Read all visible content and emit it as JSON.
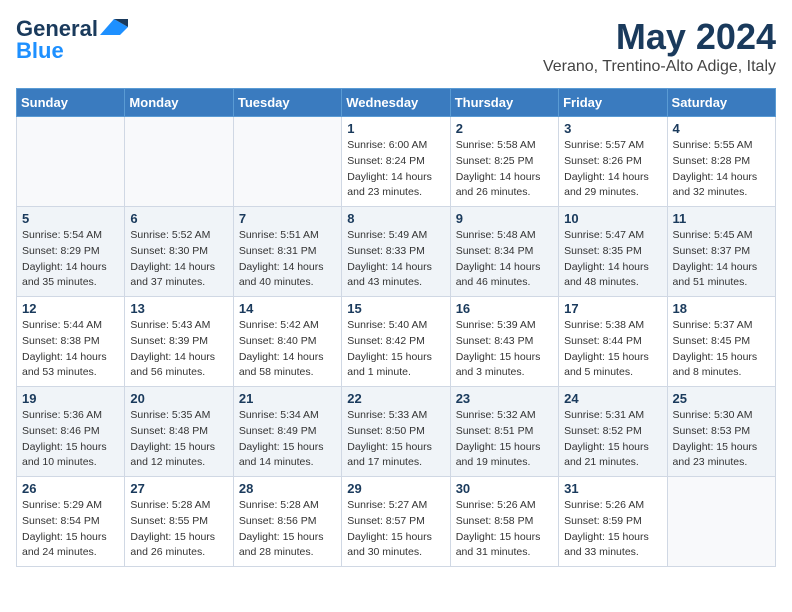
{
  "logo": {
    "general": "General",
    "blue": "Blue"
  },
  "title": "May 2024",
  "location": "Verano, Trentino-Alto Adige, Italy",
  "days_of_week": [
    "Sunday",
    "Monday",
    "Tuesday",
    "Wednesday",
    "Thursday",
    "Friday",
    "Saturday"
  ],
  "weeks": [
    [
      {
        "day": "",
        "sunrise": "",
        "sunset": "",
        "daylight": ""
      },
      {
        "day": "",
        "sunrise": "",
        "sunset": "",
        "daylight": ""
      },
      {
        "day": "",
        "sunrise": "",
        "sunset": "",
        "daylight": ""
      },
      {
        "day": "1",
        "sunrise": "Sunrise: 6:00 AM",
        "sunset": "Sunset: 8:24 PM",
        "daylight": "Daylight: 14 hours and 23 minutes."
      },
      {
        "day": "2",
        "sunrise": "Sunrise: 5:58 AM",
        "sunset": "Sunset: 8:25 PM",
        "daylight": "Daylight: 14 hours and 26 minutes."
      },
      {
        "day": "3",
        "sunrise": "Sunrise: 5:57 AM",
        "sunset": "Sunset: 8:26 PM",
        "daylight": "Daylight: 14 hours and 29 minutes."
      },
      {
        "day": "4",
        "sunrise": "Sunrise: 5:55 AM",
        "sunset": "Sunset: 8:28 PM",
        "daylight": "Daylight: 14 hours and 32 minutes."
      }
    ],
    [
      {
        "day": "5",
        "sunrise": "Sunrise: 5:54 AM",
        "sunset": "Sunset: 8:29 PM",
        "daylight": "Daylight: 14 hours and 35 minutes."
      },
      {
        "day": "6",
        "sunrise": "Sunrise: 5:52 AM",
        "sunset": "Sunset: 8:30 PM",
        "daylight": "Daylight: 14 hours and 37 minutes."
      },
      {
        "day": "7",
        "sunrise": "Sunrise: 5:51 AM",
        "sunset": "Sunset: 8:31 PM",
        "daylight": "Daylight: 14 hours and 40 minutes."
      },
      {
        "day": "8",
        "sunrise": "Sunrise: 5:49 AM",
        "sunset": "Sunset: 8:33 PM",
        "daylight": "Daylight: 14 hours and 43 minutes."
      },
      {
        "day": "9",
        "sunrise": "Sunrise: 5:48 AM",
        "sunset": "Sunset: 8:34 PM",
        "daylight": "Daylight: 14 hours and 46 minutes."
      },
      {
        "day": "10",
        "sunrise": "Sunrise: 5:47 AM",
        "sunset": "Sunset: 8:35 PM",
        "daylight": "Daylight: 14 hours and 48 minutes."
      },
      {
        "day": "11",
        "sunrise": "Sunrise: 5:45 AM",
        "sunset": "Sunset: 8:37 PM",
        "daylight": "Daylight: 14 hours and 51 minutes."
      }
    ],
    [
      {
        "day": "12",
        "sunrise": "Sunrise: 5:44 AM",
        "sunset": "Sunset: 8:38 PM",
        "daylight": "Daylight: 14 hours and 53 minutes."
      },
      {
        "day": "13",
        "sunrise": "Sunrise: 5:43 AM",
        "sunset": "Sunset: 8:39 PM",
        "daylight": "Daylight: 14 hours and 56 minutes."
      },
      {
        "day": "14",
        "sunrise": "Sunrise: 5:42 AM",
        "sunset": "Sunset: 8:40 PM",
        "daylight": "Daylight: 14 hours and 58 minutes."
      },
      {
        "day": "15",
        "sunrise": "Sunrise: 5:40 AM",
        "sunset": "Sunset: 8:42 PM",
        "daylight": "Daylight: 15 hours and 1 minute."
      },
      {
        "day": "16",
        "sunrise": "Sunrise: 5:39 AM",
        "sunset": "Sunset: 8:43 PM",
        "daylight": "Daylight: 15 hours and 3 minutes."
      },
      {
        "day": "17",
        "sunrise": "Sunrise: 5:38 AM",
        "sunset": "Sunset: 8:44 PM",
        "daylight": "Daylight: 15 hours and 5 minutes."
      },
      {
        "day": "18",
        "sunrise": "Sunrise: 5:37 AM",
        "sunset": "Sunset: 8:45 PM",
        "daylight": "Daylight: 15 hours and 8 minutes."
      }
    ],
    [
      {
        "day": "19",
        "sunrise": "Sunrise: 5:36 AM",
        "sunset": "Sunset: 8:46 PM",
        "daylight": "Daylight: 15 hours and 10 minutes."
      },
      {
        "day": "20",
        "sunrise": "Sunrise: 5:35 AM",
        "sunset": "Sunset: 8:48 PM",
        "daylight": "Daylight: 15 hours and 12 minutes."
      },
      {
        "day": "21",
        "sunrise": "Sunrise: 5:34 AM",
        "sunset": "Sunset: 8:49 PM",
        "daylight": "Daylight: 15 hours and 14 minutes."
      },
      {
        "day": "22",
        "sunrise": "Sunrise: 5:33 AM",
        "sunset": "Sunset: 8:50 PM",
        "daylight": "Daylight: 15 hours and 17 minutes."
      },
      {
        "day": "23",
        "sunrise": "Sunrise: 5:32 AM",
        "sunset": "Sunset: 8:51 PM",
        "daylight": "Daylight: 15 hours and 19 minutes."
      },
      {
        "day": "24",
        "sunrise": "Sunrise: 5:31 AM",
        "sunset": "Sunset: 8:52 PM",
        "daylight": "Daylight: 15 hours and 21 minutes."
      },
      {
        "day": "25",
        "sunrise": "Sunrise: 5:30 AM",
        "sunset": "Sunset: 8:53 PM",
        "daylight": "Daylight: 15 hours and 23 minutes."
      }
    ],
    [
      {
        "day": "26",
        "sunrise": "Sunrise: 5:29 AM",
        "sunset": "Sunset: 8:54 PM",
        "daylight": "Daylight: 15 hours and 24 minutes."
      },
      {
        "day": "27",
        "sunrise": "Sunrise: 5:28 AM",
        "sunset": "Sunset: 8:55 PM",
        "daylight": "Daylight: 15 hours and 26 minutes."
      },
      {
        "day": "28",
        "sunrise": "Sunrise: 5:28 AM",
        "sunset": "Sunset: 8:56 PM",
        "daylight": "Daylight: 15 hours and 28 minutes."
      },
      {
        "day": "29",
        "sunrise": "Sunrise: 5:27 AM",
        "sunset": "Sunset: 8:57 PM",
        "daylight": "Daylight: 15 hours and 30 minutes."
      },
      {
        "day": "30",
        "sunrise": "Sunrise: 5:26 AM",
        "sunset": "Sunset: 8:58 PM",
        "daylight": "Daylight: 15 hours and 31 minutes."
      },
      {
        "day": "31",
        "sunrise": "Sunrise: 5:26 AM",
        "sunset": "Sunset: 8:59 PM",
        "daylight": "Daylight: 15 hours and 33 minutes."
      },
      {
        "day": "",
        "sunrise": "",
        "sunset": "",
        "daylight": ""
      }
    ]
  ]
}
